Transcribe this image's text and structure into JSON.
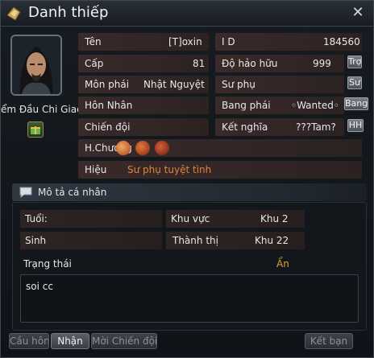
{
  "window": {
    "title": "Danh thiếp",
    "close_icon": "close-icon"
  },
  "character": {
    "name_label": "ểm Đầu Chi Giao"
  },
  "fields": {
    "ten": {
      "label": "Tên",
      "value": "[T]oxin"
    },
    "id": {
      "label": "I D",
      "value": "184560"
    },
    "cap": {
      "label": "Cấp",
      "value": "81"
    },
    "do_hao_huu": {
      "label": "Độ hảo hữu",
      "value": "999"
    },
    "mon_phai": {
      "label": "Môn phái",
      "value": "Nhật Nguyệt"
    },
    "su_phu": {
      "label": "Sư phụ",
      "value": ""
    },
    "hon_nhan": {
      "label": "Hôn Nhân",
      "value": ""
    },
    "bang_phai": {
      "label": "Bang phái",
      "value": "◦Wanted◦"
    },
    "chien_doi": {
      "label": "Chiến đội",
      "value": ""
    },
    "ket_nghia": {
      "label": "Kết nghĩa",
      "value": "???Tam?"
    },
    "h_chuong": {
      "label": "H.Chương",
      "value": ""
    },
    "hieu": {
      "label": "Hiệu",
      "value": "Sư phụ tuyệt tình"
    }
  },
  "side_buttons": {
    "tro": "Trợ",
    "su": "Sư",
    "bang": "Bang",
    "hh": "HH"
  },
  "profile": {
    "section_title": "Mô tả cá nhân",
    "tuoi": {
      "label": "Tuổi:",
      "value": ""
    },
    "khu_vuc": {
      "label": "Khu vực",
      "value": "Khu 2"
    },
    "sinh": {
      "label": "Sinh",
      "value": ""
    },
    "thanh_thi": {
      "label": "Thành thị",
      "value": "Khu 22"
    },
    "trang_thai": {
      "label": "Trạng thái",
      "value": "Ẩn"
    },
    "bio": "soi cc"
  },
  "buttons": {
    "cau_hon": "Cầu hôn",
    "nhan": "Nhận",
    "moi_chien_doi": "Mời Chiến đội",
    "ket_ban": "Kết bạn"
  },
  "colors": {
    "accent_orange": "#e0833a",
    "status_gold": "#e0a033"
  }
}
